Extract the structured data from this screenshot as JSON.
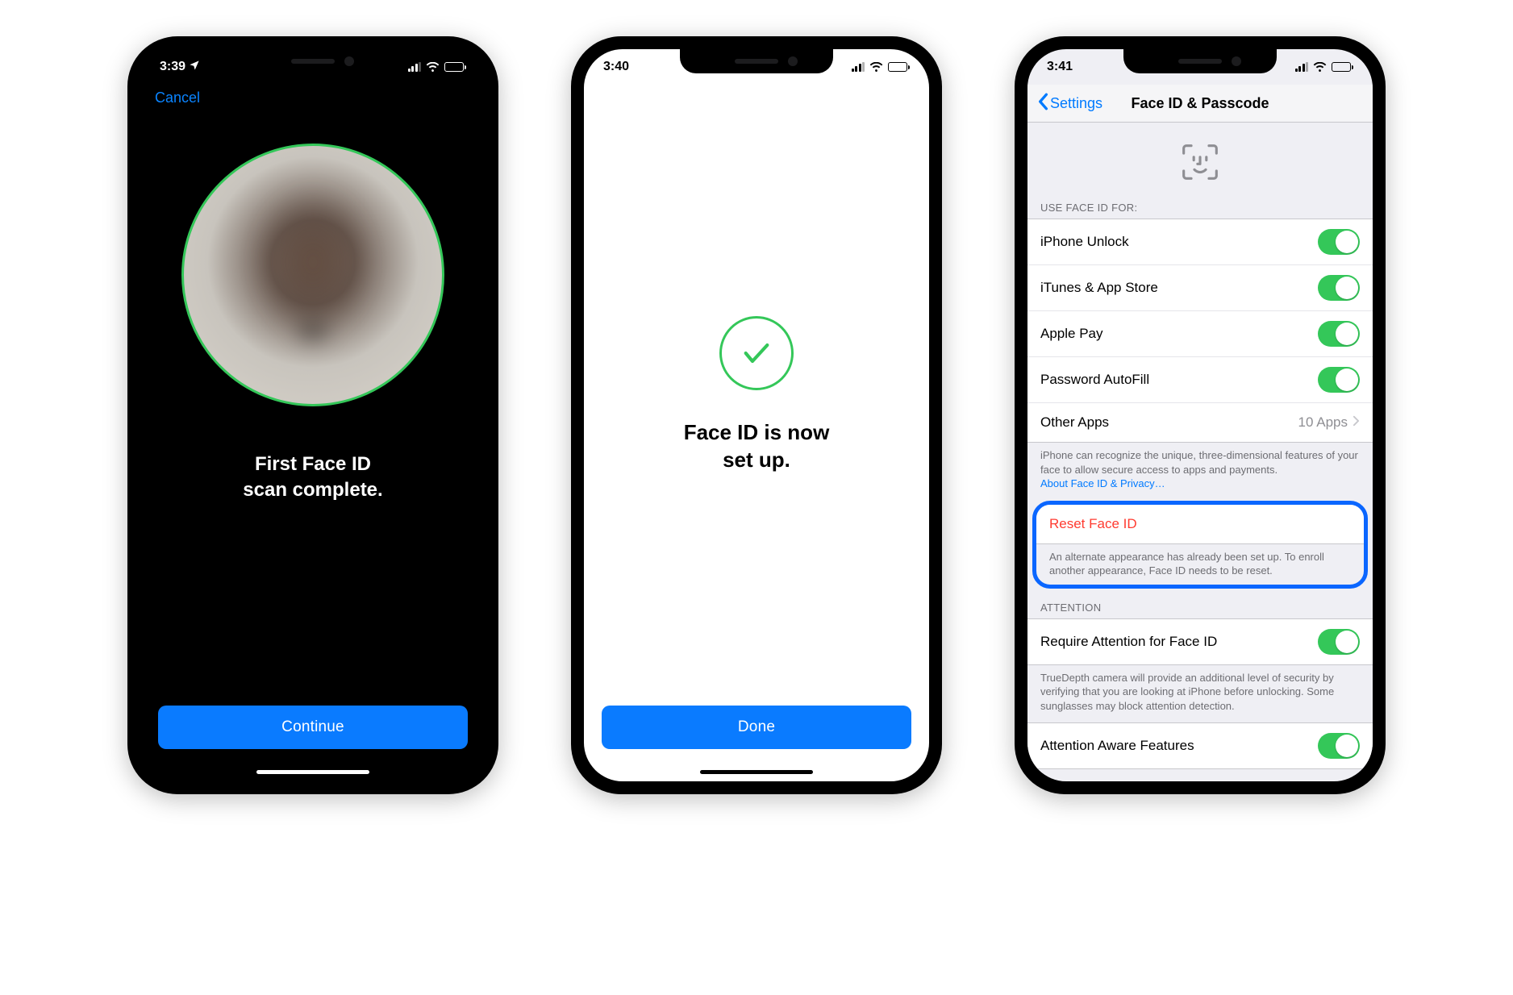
{
  "screen1": {
    "status_time": "3:39",
    "cancel_label": "Cancel",
    "message": "First Face ID\nscan complete.",
    "continue_label": "Continue"
  },
  "screen2": {
    "status_time": "3:40",
    "message": "Face ID is now\nset up.",
    "done_label": "Done"
  },
  "screen3": {
    "status_time": "3:41",
    "back_label": "Settings",
    "nav_title": "Face ID & Passcode",
    "use_for_header": "USE FACE ID FOR:",
    "rows": {
      "iphone_unlock": "iPhone Unlock",
      "itunes": "iTunes & App Store",
      "apple_pay": "Apple Pay",
      "password_autofill": "Password AutoFill",
      "other_apps": "Other Apps",
      "other_apps_detail": "10 Apps"
    },
    "privacy_footer": "iPhone can recognize the unique, three-dimensional features of your face to allow secure access to apps and payments.",
    "privacy_link": "About Face ID & Privacy…",
    "reset_label": "Reset Face ID",
    "reset_footer": "An alternate appearance has already been set up. To enroll another appearance, Face ID needs to be reset.",
    "attention_header": "ATTENTION",
    "require_attention": "Require Attention for Face ID",
    "attention_footer": "TrueDepth camera will provide an additional level of security by verifying that you are looking at iPhone before unlocking. Some sunglasses may block attention detection.",
    "attention_aware": "Attention Aware Features"
  }
}
